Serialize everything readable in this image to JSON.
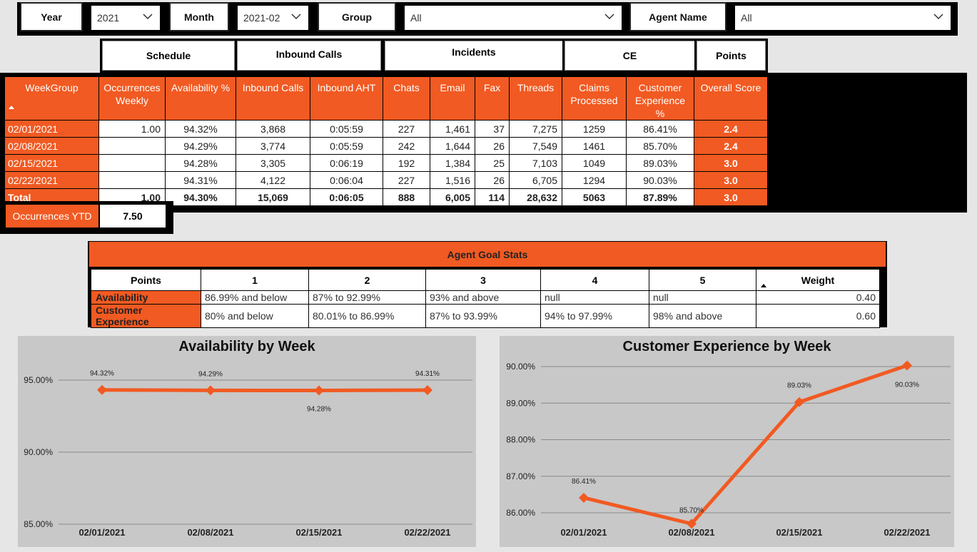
{
  "slicers": {
    "year_label": "Year",
    "year_value": "2021",
    "month_label": "Month",
    "month_value": "2021-02",
    "group_label": "Group",
    "group_value": "All",
    "agent_label": "Agent Name",
    "agent_value": "All"
  },
  "sections": {
    "schedule": "Schedule",
    "inbound_calls": "Inbound Calls",
    "incidents": "Incidents",
    "ce": "CE",
    "points": "Points"
  },
  "kpi_table": {
    "headers": [
      "WeekGroup",
      "Occurrences Weekly",
      "Availability %",
      "Inbound Calls",
      "Inbound AHT",
      "Chats",
      "Email",
      "Fax",
      "Threads",
      "Claims Processed",
      "Customer Experience %",
      "Overall Score"
    ],
    "rows": [
      [
        "02/01/2021",
        "1.00",
        "94.32%",
        "3,868",
        "0:05:59",
        "227",
        "1,461",
        "37",
        "7,275",
        "1259",
        "86.41%",
        "2.4"
      ],
      [
        "02/08/2021",
        "",
        "94.29%",
        "3,774",
        "0:05:59",
        "242",
        "1,644",
        "26",
        "7,549",
        "1461",
        "85.70%",
        "2.4"
      ],
      [
        "02/15/2021",
        "",
        "94.28%",
        "3,305",
        "0:06:19",
        "192",
        "1,384",
        "25",
        "7,103",
        "1049",
        "89.03%",
        "3.0"
      ],
      [
        "02/22/2021",
        "",
        "94.31%",
        "4,122",
        "0:06:04",
        "227",
        "1,516",
        "26",
        "6,705",
        "1294",
        "90.03%",
        "3.0"
      ]
    ],
    "total": [
      "Total",
      "1.00",
      "94.30%",
      "15,069",
      "0:06:05",
      "888",
      "6,005",
      "114",
      "28,632",
      "5063",
      "87.89%",
      "3.0"
    ]
  },
  "occurrences_ytd": {
    "label": "Occurrences YTD",
    "value": "7.50"
  },
  "goal_stats": {
    "title": "Agent Goal Stats",
    "headers": [
      "Points",
      "1",
      "2",
      "3",
      "4",
      "5",
      "Weight"
    ],
    "rows": [
      [
        "Availability",
        "86.99% and below",
        "87% to 92.99%",
        "93% and above",
        "null",
        "null",
        "0.40"
      ],
      [
        "Customer Experience",
        "80% and below",
        "80.01% to 86.99%",
        "87% to 93.99%",
        "94% to 97.99%",
        "98% and above",
        "0.60"
      ]
    ]
  },
  "chart_data": [
    {
      "type": "line",
      "title": "Availability by Week",
      "categories": [
        "02/01/2021",
        "02/08/2021",
        "02/15/2021",
        "02/22/2021"
      ],
      "values": [
        94.32,
        94.29,
        94.28,
        94.31
      ],
      "labels": [
        "94.32%",
        "94.29%",
        "94.28%",
        "94.31%"
      ],
      "yticks": [
        "95.00%",
        "90.00%",
        "85.00%"
      ],
      "ylim": [
        85,
        95
      ],
      "color": "#f15a22",
      "grid": true
    },
    {
      "type": "line",
      "title": "Customer Experience by Week",
      "categories": [
        "02/01/2021",
        "02/08/2021",
        "02/15/2021",
        "02/22/2021"
      ],
      "values": [
        86.41,
        85.7,
        89.03,
        90.03
      ],
      "labels": [
        "86.41%",
        "85.70%",
        "89.03%",
        "90.03%"
      ],
      "yticks": [
        "90.00%",
        "89.00%",
        "88.00%",
        "87.00%",
        "86.00%"
      ],
      "ylim": [
        86,
        90
      ],
      "color": "#f15a22",
      "grid": true
    }
  ]
}
